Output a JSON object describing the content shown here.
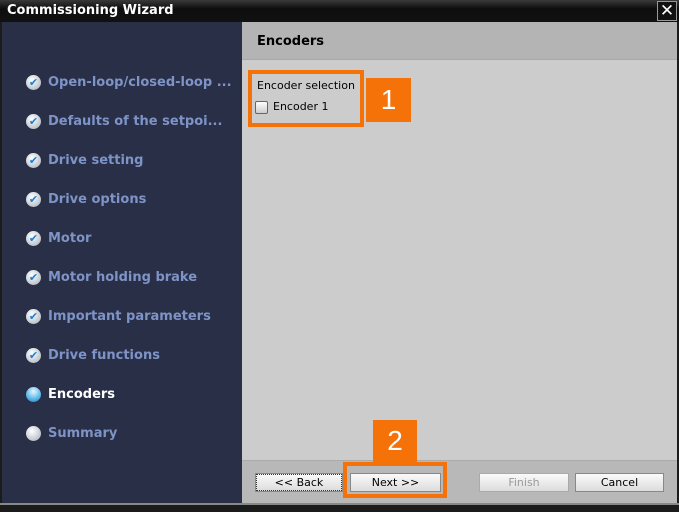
{
  "window": {
    "title": "Commissioning Wizard",
    "close_icon": "close-icon"
  },
  "sidebar": {
    "items": [
      {
        "label": "Open-loop/closed-loop ...",
        "state": "done"
      },
      {
        "label": "Defaults of the setpoi...",
        "state": "done"
      },
      {
        "label": "Drive setting",
        "state": "done"
      },
      {
        "label": "Drive options",
        "state": "done"
      },
      {
        "label": "Motor",
        "state": "done"
      },
      {
        "label": "Motor holding brake",
        "state": "done"
      },
      {
        "label": "Important parameters",
        "state": "done"
      },
      {
        "label": "Drive functions",
        "state": "done"
      },
      {
        "label": "Encoders",
        "state": "current"
      },
      {
        "label": "Summary",
        "state": "pending"
      }
    ]
  },
  "main": {
    "title": "Encoders",
    "group_label": "Encoder selection",
    "checkbox_label": "Encoder 1",
    "checkbox_checked": false
  },
  "buttons": {
    "back": "<< Back",
    "next": "Next >>",
    "finish": "Finish",
    "cancel": "Cancel"
  },
  "annotations": {
    "one": "1",
    "two": "2",
    "color": "#f57208"
  }
}
